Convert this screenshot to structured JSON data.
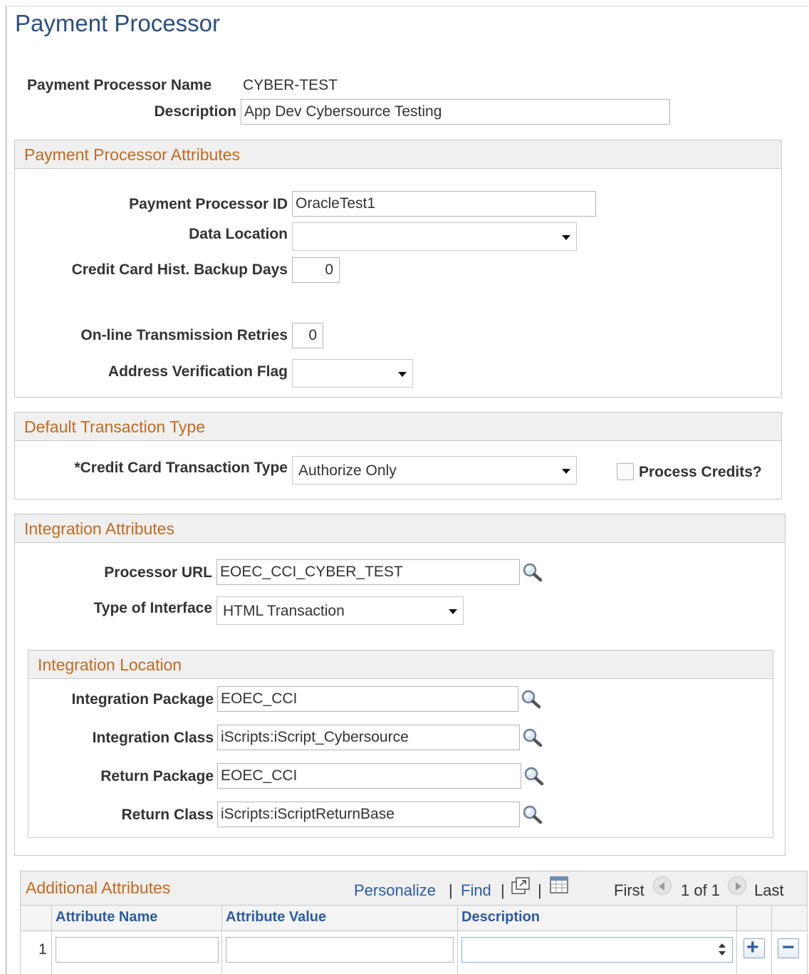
{
  "page": {
    "title": "Payment Processor"
  },
  "header": {
    "name_label": "Payment Processor Name",
    "name_value": "CYBER-TEST",
    "description_label": "Description",
    "description_value": "App Dev Cybersource Testing"
  },
  "attributes": {
    "title": "Payment Processor Attributes",
    "processor_id_label": "Payment Processor ID",
    "processor_id_value": "OracleTest1",
    "data_location_label": "Data Location",
    "data_location_value": "",
    "backup_days_label": "Credit Card Hist. Backup Days",
    "backup_days_value": "0",
    "retries_label": "On-line Transmission Retries",
    "retries_value": "0",
    "avs_label": "Address Verification Flag",
    "avs_value": ""
  },
  "transaction": {
    "title": "Default Transaction Type",
    "type_label": "*Credit Card Transaction Type",
    "type_value": "Authorize Only",
    "process_credits_label": "Process Credits?",
    "process_credits_checked": false
  },
  "integration": {
    "title": "Integration Attributes",
    "url_label": "Processor URL",
    "url_value": "EOEC_CCI_CYBER_TEST",
    "interface_label": "Type of Interface",
    "interface_value": "HTML Transaction"
  },
  "location": {
    "title": "Integration Location",
    "package_label": "Integration Package",
    "package_value": "EOEC_CCI",
    "class_label": "Integration Class",
    "class_value": "iScripts:iScript_Cybersource",
    "return_package_label": "Return Package",
    "return_package_value": "EOEC_CCI",
    "return_class_label": "Return Class",
    "return_class_value": "iScripts:iScriptReturnBase"
  },
  "additional": {
    "title": "Additional Attributes",
    "personalize": "Personalize",
    "find": "Find",
    "separator": "|",
    "first": "First",
    "range": "1 of 1",
    "last": "Last",
    "columns": [
      "Attribute Name",
      "Attribute Value",
      "Description"
    ],
    "rows": [
      {
        "num": "1",
        "name": "",
        "value": "",
        "description": ""
      }
    ]
  },
  "colors": {
    "title": "#2a4f80",
    "section_title": "#c36a1f",
    "link": "#2a5ca6"
  }
}
